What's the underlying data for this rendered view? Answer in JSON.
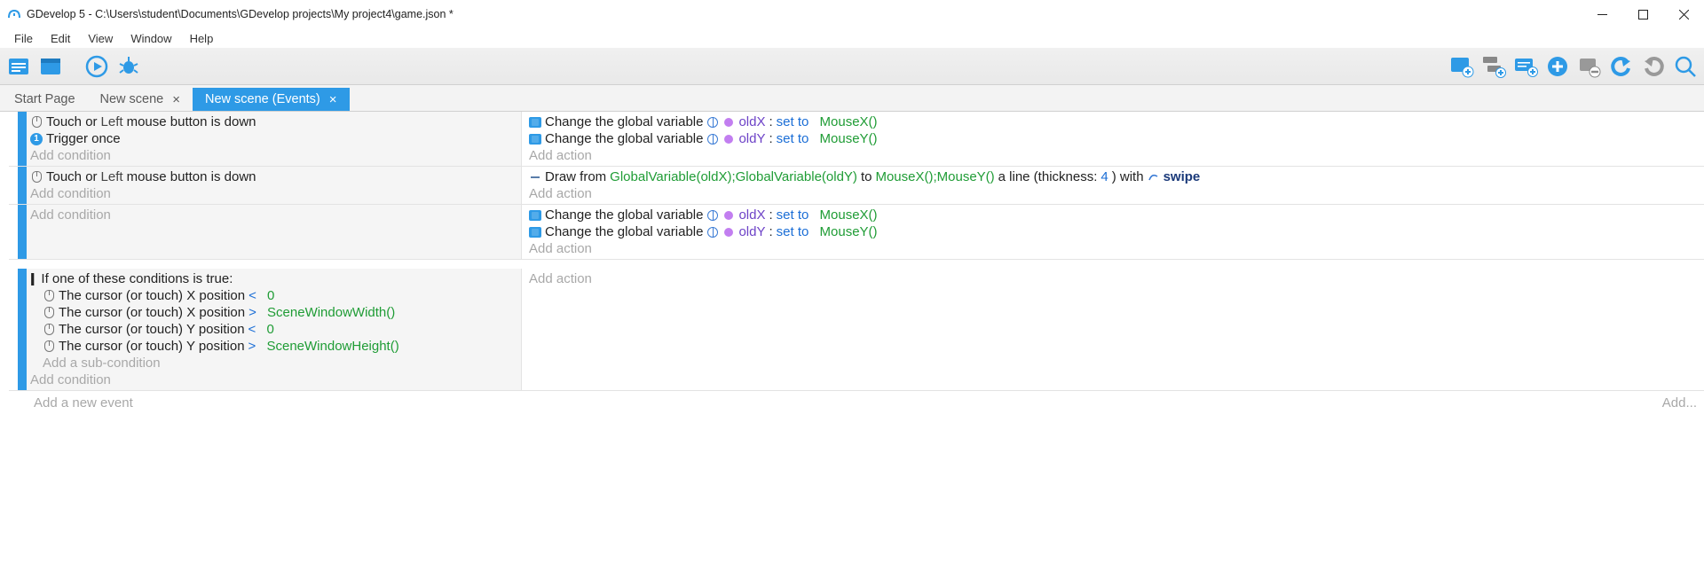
{
  "window": {
    "title": "GDevelop 5 - C:\\Users\\student\\Documents\\GDevelop projects\\My project4\\game.json *"
  },
  "menu": {
    "items": [
      "File",
      "Edit",
      "View",
      "Window",
      "Help"
    ]
  },
  "tabs": {
    "items": [
      {
        "label": "Start Page",
        "closable": false,
        "active": false
      },
      {
        "label": "New scene",
        "closable": true,
        "active": false
      },
      {
        "label": "New scene (Events)",
        "closable": true,
        "active": true
      }
    ]
  },
  "events": {
    "rows": [
      {
        "conditions": [
          {
            "kind": "mouse",
            "pre": "Touch or ",
            "mid": "Left",
            "post": " mouse button is down"
          },
          {
            "kind": "trigger",
            "text": "Trigger once"
          }
        ],
        "add_condition": "Add condition",
        "actions": [
          {
            "kind": "var",
            "pre": "Change the global variable ",
            "var": "oldX",
            "sep": ": ",
            "op": "set to",
            "val": "MouseX()"
          },
          {
            "kind": "var",
            "pre": "Change the global variable ",
            "var": "oldY",
            "sep": ": ",
            "op": "set to",
            "val": "MouseY()"
          }
        ],
        "add_action": "Add action"
      },
      {
        "conditions": [
          {
            "kind": "mouse",
            "pre": "Touch or ",
            "mid": "Left",
            "post": " mouse button is down"
          }
        ],
        "add_condition": "Add condition",
        "actions": [
          {
            "kind": "draw",
            "pre": "Draw from ",
            "from": "GlobalVariable(oldX);GlobalVariable(oldY)",
            "mid": " to ",
            "to": "MouseX();MouseY()",
            "suffix1": " a line (thickness: ",
            "thickness": "4",
            "suffix2": ") with ",
            "obj": "swipe"
          }
        ],
        "add_action": "Add action"
      },
      {
        "conditions": [],
        "add_condition": "Add condition",
        "actions": [
          {
            "kind": "var",
            "pre": "Change the global variable ",
            "var": "oldX",
            "sep": ": ",
            "op": "set to",
            "val": "MouseX()"
          },
          {
            "kind": "var",
            "pre": "Change the global variable ",
            "var": "oldY",
            "sep": ": ",
            "op": "set to",
            "val": "MouseY()"
          }
        ],
        "add_action": "Add action"
      },
      {
        "or_header": "If one of these conditions is true:",
        "conditions": [
          {
            "kind": "cursor",
            "pre": "The cursor (or touch) X position ",
            "op": "<",
            "val": "0"
          },
          {
            "kind": "cursor",
            "pre": "The cursor (or touch) X position ",
            "op": ">",
            "val": "SceneWindowWidth()"
          },
          {
            "kind": "cursor",
            "pre": "The cursor (or touch) Y position ",
            "op": "<",
            "val": "0"
          },
          {
            "kind": "cursor",
            "pre": "The cursor (or touch) Y position ",
            "op": ">",
            "val": "SceneWindowHeight()"
          }
        ],
        "add_sub_condition": "Add a sub-condition",
        "add_condition": "Add condition",
        "actions": [],
        "add_action": "Add action"
      }
    ],
    "add_event": "Add a new event",
    "add_right": "Add..."
  }
}
